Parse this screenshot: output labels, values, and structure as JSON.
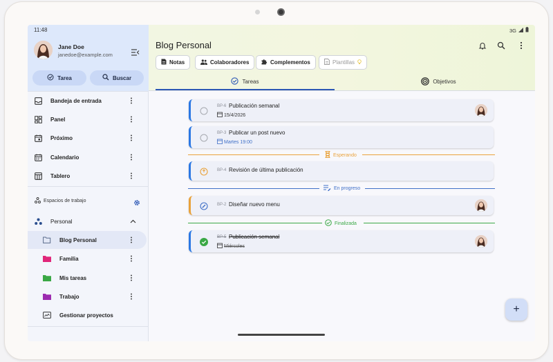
{
  "status": {
    "time": "11:48",
    "network": "3G"
  },
  "user": {
    "name": "Jane Doe",
    "email": "janedoe@example.com"
  },
  "sidebar": {
    "actions": [
      {
        "label": "Tarea",
        "icon": "add-task-icon"
      },
      {
        "label": "Buscar",
        "icon": "search-icon"
      }
    ],
    "items": [
      {
        "label": "Bandeja de entrada",
        "icon": "inbox-icon"
      },
      {
        "label": "Panel",
        "icon": "dashboard-icon"
      },
      {
        "label": "Próximo",
        "icon": "calendar-upcoming-icon"
      },
      {
        "label": "Calendario",
        "icon": "calendar-icon"
      },
      {
        "label": "Tablero",
        "icon": "board-icon"
      }
    ],
    "workspaces_title": "Espacios de trabajo",
    "workspace": {
      "label": "Personal",
      "icon": "workspace-dots-icon"
    },
    "projects": [
      {
        "label": "Blog Personal",
        "color": "#5a6b8c",
        "active": true
      },
      {
        "label": "Familia",
        "color": "#e0267a"
      },
      {
        "label": "Mis tareas",
        "color": "#3aa845"
      },
      {
        "label": "Trabajo",
        "color": "#9c2bb0"
      }
    ],
    "manage_label": "Gestionar proyectos"
  },
  "header": {
    "title": "Blog Personal",
    "chips": [
      {
        "label": "Notas",
        "icon": "note-icon",
        "disabled": false
      },
      {
        "label": "Colaboradores",
        "icon": "people-icon",
        "disabled": false
      },
      {
        "label": "Complementos",
        "icon": "puzzle-icon",
        "disabled": false
      },
      {
        "label": "Plantillas",
        "icon": "template-icon",
        "disabled": true
      }
    ],
    "tabs": [
      {
        "label": "Tareas",
        "icon": "check-circle-icon",
        "active": true
      },
      {
        "label": "Objetivos",
        "icon": "target-icon",
        "active": false
      }
    ]
  },
  "tasks_top": [
    {
      "code": "BP-6",
      "title": "Publicación semanal",
      "date": "15/4/2026",
      "date_color": "default",
      "has_avatar": true
    },
    {
      "code": "BP-3",
      "title": "Publicar un post nuevo",
      "date": "Martes 19:00",
      "date_color": "blue",
      "has_avatar": false
    }
  ],
  "groups": [
    {
      "label": "Esperando",
      "color": "#e9a23b",
      "icon": "hourglass-icon"
    },
    {
      "label": "En progreso",
      "color": "#3f6fc7",
      "icon": "edit-list-icon"
    },
    {
      "label": "Finalizada",
      "color": "#3aa845",
      "icon": "check-outline-icon"
    }
  ],
  "task_waiting": {
    "code": "BP-4",
    "title": "Revisión de última publicación"
  },
  "task_progress": {
    "code": "BP-2",
    "title": "Diseñar nuevo menu"
  },
  "task_done": {
    "code": "BP-5",
    "title": "Publicación semanal",
    "date": "Miércoles"
  },
  "fab": {
    "label": "+"
  }
}
